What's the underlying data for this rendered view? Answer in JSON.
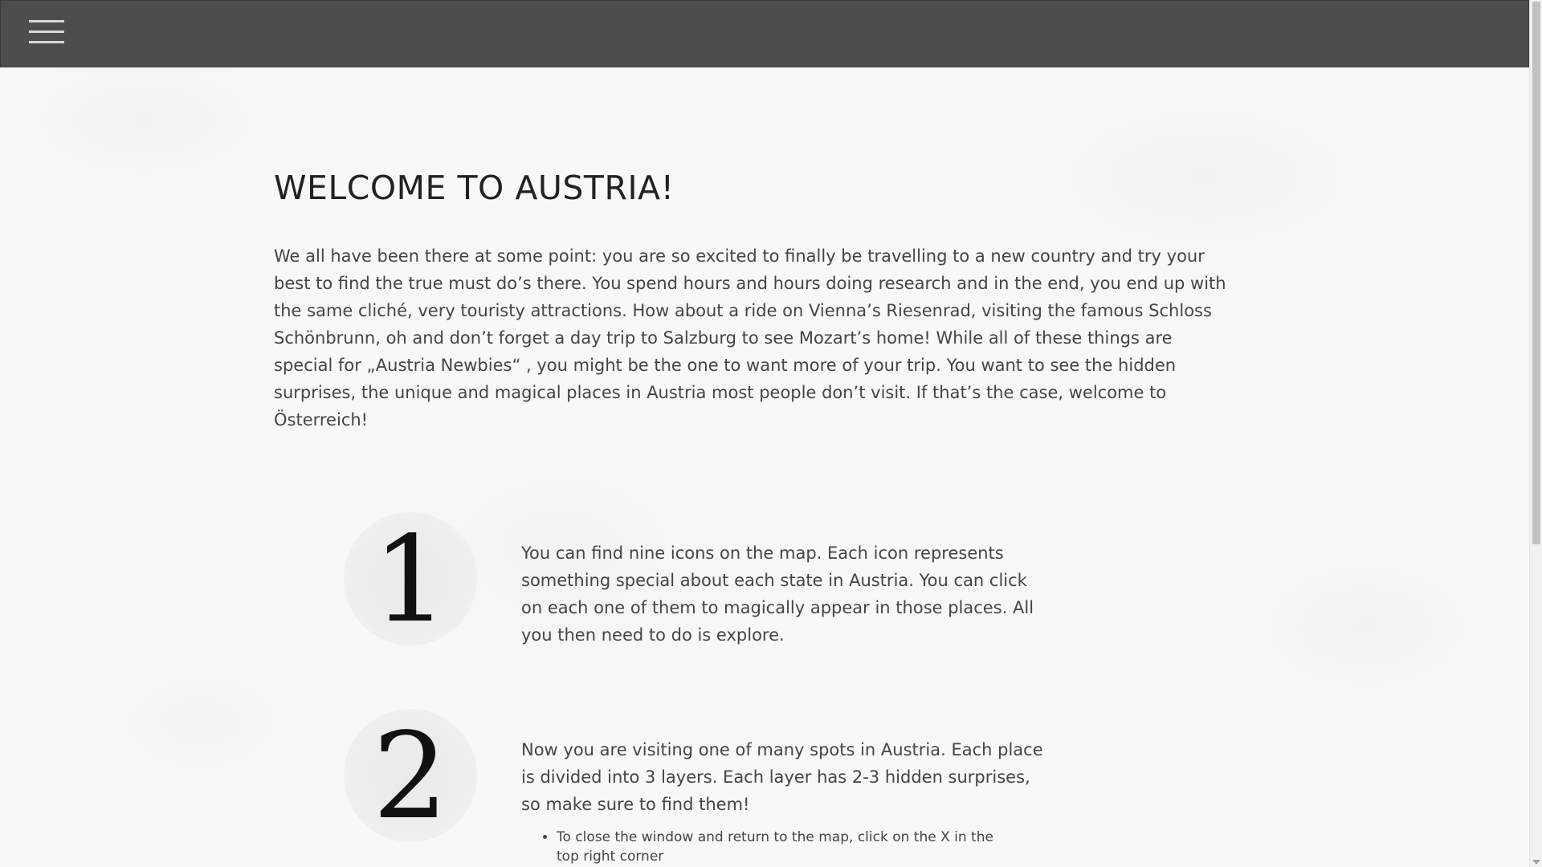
{
  "header": {
    "menu_icon": "hamburger-menu-icon"
  },
  "main": {
    "title": "WELCOME TO AUSTRIA!",
    "intro": "We all have been there at some point: you are so excited to finally be travelling to a new country and try your best to find the true must do’s there. You spend hours and hours doing research and in the end, you end up with the same cliché, very touristy attractions. How about a ride on Vienna’s Riesenrad, visiting the famous Schloss Schönbrunn, oh and don’t forget a day trip to Salzburg to see Mozart’s home! While all of these things are special for „Austria Newbies“ , you might be the one to want more of your trip. You want to see the hidden surprises, the unique and magical places in Austria most people don’t visit. If that’s the case, welcome to Österreich!"
  },
  "steps": [
    {
      "number": "1",
      "text": "You can find nine icons on the map. Each icon represents something special about each state in Austria. You can click on each one of them to magically appear in those places. All you then need to do is explore."
    },
    {
      "number": "2",
      "text": "Now you are visiting one of many spots in Austria. Each place is divided into 3 layers. Each layer has 2-3 hidden surprises, so make sure to find them!",
      "bullets": [
        "To close the window and return to the map, click on the X in the top right corner"
      ]
    }
  ]
}
